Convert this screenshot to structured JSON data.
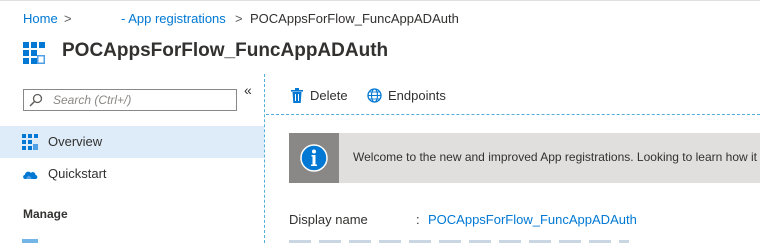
{
  "breadcrumb": {
    "items": [
      {
        "label": "Home"
      },
      {
        "label": "- App registrations"
      },
      {
        "label": "POCAppsForFlow_FuncAppADAuth"
      }
    ],
    "separator": ">"
  },
  "page": {
    "title": "POCAppsForFlow_FuncAppADAuth",
    "icon": "app-registration-grid-icon"
  },
  "sidebar": {
    "search": {
      "placeholder": "Search (Ctrl+/)"
    },
    "collapse_glyph": "«",
    "items": [
      {
        "label": "Overview",
        "icon": "overview-grid-icon",
        "selected": true
      },
      {
        "label": "Quickstart",
        "icon": "quickstart-cloud-icon",
        "selected": false
      }
    ],
    "section_header": "Manage"
  },
  "toolbar": {
    "delete_label": "Delete",
    "endpoints_label": "Endpoints"
  },
  "banner": {
    "icon": "info-icon",
    "text": "Welcome to the new and improved App registrations. Looking to learn how it"
  },
  "essentials": {
    "display_name_label": "Display name",
    "display_name_colon": ":",
    "display_name_value": "POCAppsForFlow_FuncAppADAuth"
  },
  "colors": {
    "accent": "#0078d4",
    "selected_bg": "#deecf9",
    "banner_bg": "#e1dfdd",
    "banner_icon_bg": "#8a8886",
    "divider": "#52b0d8"
  }
}
